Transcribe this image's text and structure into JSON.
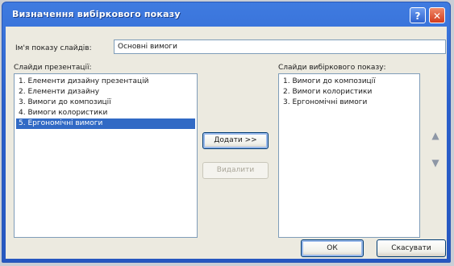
{
  "dialog": {
    "title": "Визначення вибіркового показу",
    "help_label": "?",
    "close_label": "✕"
  },
  "name_field": {
    "label": "Ім'я показу слайдів:",
    "value": "Основні вимоги"
  },
  "presentation_slides": {
    "label": "Слайди презентації:",
    "items": [
      "1. Елементи дизайну презентацій",
      "2. Елементи дизайну",
      "3. Вимоги до композиції",
      "4. Вимоги колористики",
      "5. Ергономічні вимоги"
    ],
    "selected_index": 4
  },
  "custom_show_slides": {
    "label": "Слайди вибіркового показу:",
    "items": [
      "1. Вимоги до композиції",
      "2. Вимоги колористики",
      "3. Ергономічні вимоги"
    ]
  },
  "buttons": {
    "add": "Додати >>",
    "remove": "Видалити",
    "ok": "ОК",
    "cancel": "Скасувати"
  },
  "icons": {
    "move_up": "arrow-up-icon",
    "move_down": "arrow-down-icon"
  },
  "colors": {
    "titlebar": "#2a5fcb",
    "selection": "#316ac5",
    "dialog_bg": "#eceae0"
  }
}
